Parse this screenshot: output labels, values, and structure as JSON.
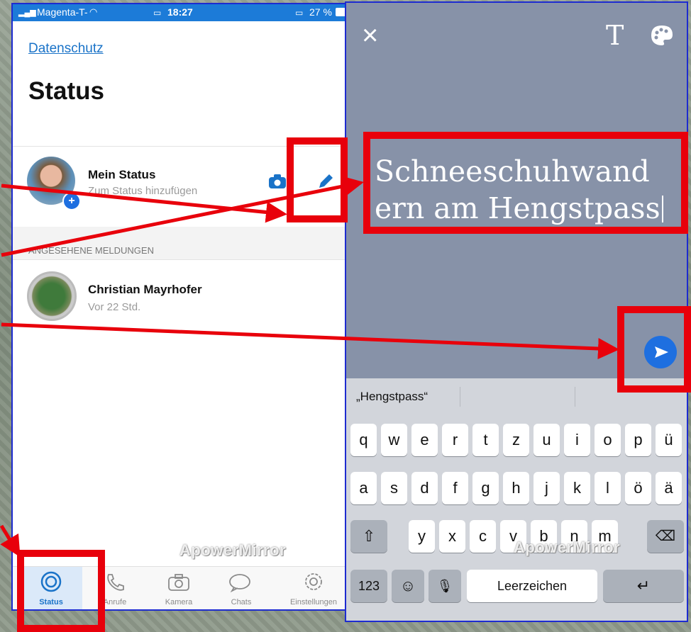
{
  "left_phone": {
    "statusbar": {
      "carrier": "Magenta-T-",
      "time": "18:27",
      "battery": "27 %"
    },
    "privacy_link": "Datenschutz",
    "page_title": "Status",
    "my_status": {
      "name": "Mein Status",
      "subtitle": "Zum Status hinzufügen"
    },
    "section_header": "ANGESEHENE MELDUNGEN",
    "contact": {
      "name": "Christian Mayrhofer",
      "time": "Vor 22 Std."
    },
    "tabs": [
      {
        "label": "Status",
        "icon": "status-icon"
      },
      {
        "label": "Anrufe",
        "icon": "phone-icon"
      },
      {
        "label": "Kamera",
        "icon": "camera-icon"
      },
      {
        "label": "Chats",
        "icon": "chat-icon"
      },
      {
        "label": "Einstellungen",
        "icon": "gear-icon"
      }
    ],
    "watermark": "ApowerMirror"
  },
  "right_phone": {
    "top_icons": {
      "close": "×",
      "text": "T"
    },
    "typed_text": "Schneeschuhwandern am Hengstpass",
    "typed_line1": "Schneeschuhwand",
    "typed_line2": "ern am Hengstpass",
    "suggestion": "„Hengstpass“",
    "keyboard": {
      "row1": [
        "q",
        "w",
        "e",
        "r",
        "t",
        "z",
        "u",
        "i",
        "o",
        "p",
        "ü"
      ],
      "row2": [
        "a",
        "s",
        "d",
        "f",
        "g",
        "h",
        "j",
        "k",
        "l",
        "ö",
        "ä"
      ],
      "row3": [
        "y",
        "x",
        "c",
        "v",
        "b",
        "n",
        "m"
      ],
      "numbers_key": "123",
      "space_key": "Leerzeichen"
    },
    "watermark": "ApowerMirror"
  },
  "colors": {
    "annotation_red": "#e8000b",
    "frame_blue": "#1d2bd0",
    "link_blue": "#1a73c8",
    "send_blue": "#1e6fe0",
    "editor_bg": "#8792a8"
  }
}
